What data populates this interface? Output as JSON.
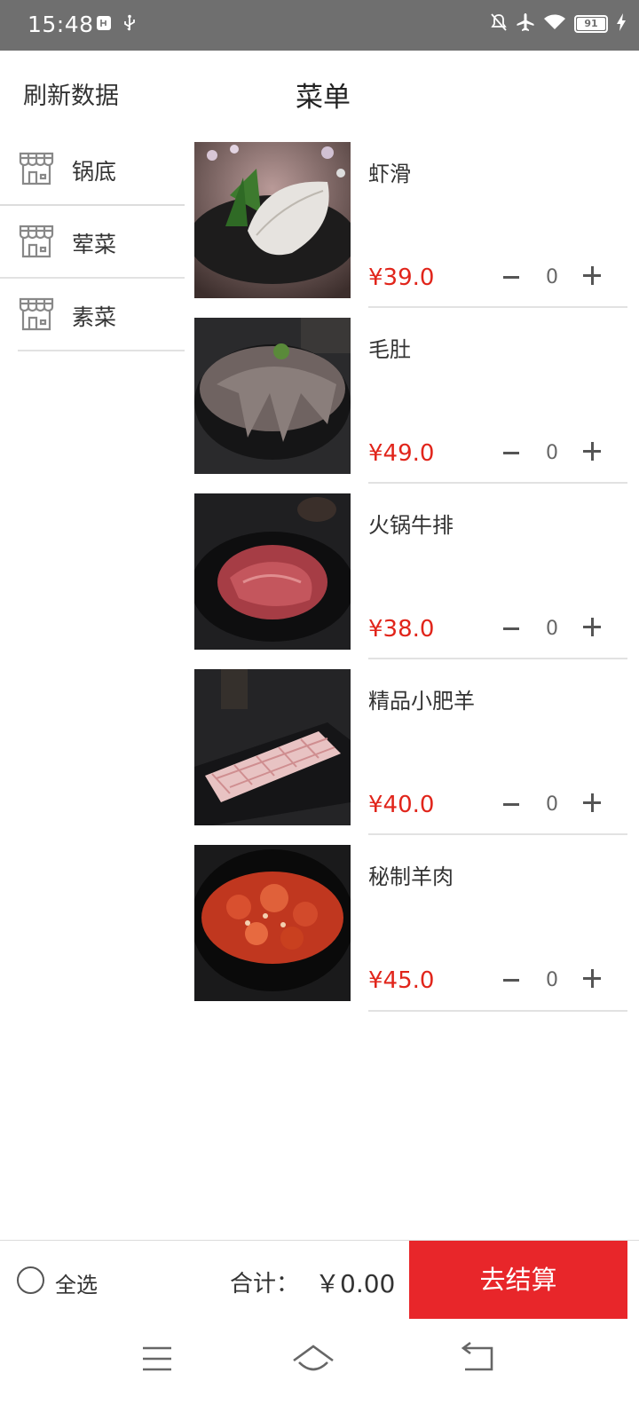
{
  "status_bar": {
    "time": "15:48",
    "battery": "91",
    "icons": [
      "usb-debug-icon",
      "usb-icon",
      "mute-icon",
      "airplane-icon",
      "wifi-icon",
      "battery-icon",
      "charging-icon"
    ]
  },
  "header": {
    "refresh_label": "刷新数据",
    "title": "菜单"
  },
  "sidebar": {
    "icon": "store-icon",
    "items": [
      {
        "label": "锅底"
      },
      {
        "label": "荤菜"
      },
      {
        "label": "素菜"
      }
    ]
  },
  "products": [
    {
      "name": "虾滑",
      "price": "¥39.0",
      "qty": "0"
    },
    {
      "name": "毛肚",
      "price": "¥49.0",
      "qty": "0"
    },
    {
      "name": "火锅牛排",
      "price": "¥38.0",
      "qty": "0"
    },
    {
      "name": "精品小肥羊",
      "price": "¥40.0",
      "qty": "0"
    },
    {
      "name": "秘制羊肉",
      "price": "¥45.0",
      "qty": "0"
    }
  ],
  "bottom_bar": {
    "select_all_label": "全选",
    "total_label": "合计：",
    "total_value": "￥0.00",
    "checkout_label": "去结算"
  },
  "colors": {
    "accent": "#e8262a",
    "price": "#e1251b",
    "status_bar": "#6f6f6f"
  }
}
